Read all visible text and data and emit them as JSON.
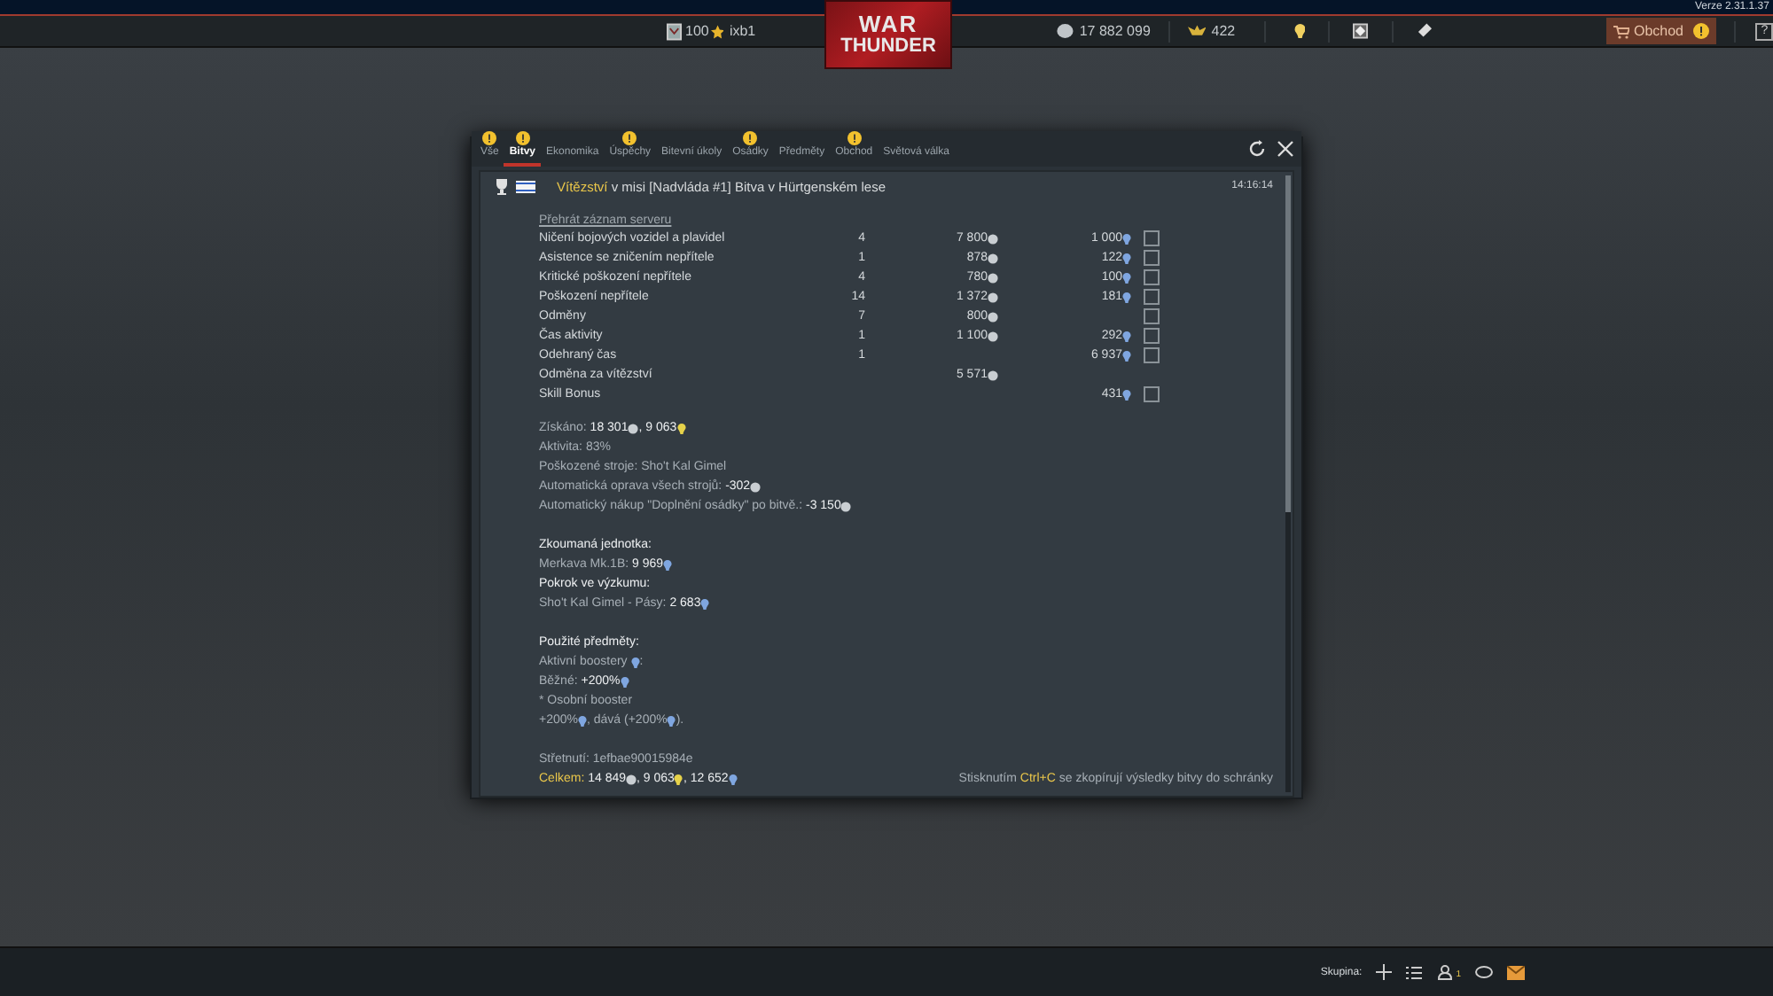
{
  "top_bar": {
    "version": "Verze 2.31.1.37",
    "rank": "100",
    "nickname": "ixb1",
    "logo": {
      "line_1": "WAR",
      "line_2": "THUNDER"
    },
    "silver": "17 882 099",
    "golden_eagles": "422",
    "shop": {
      "label": "Obchod",
      "alert": true
    },
    "help": "?"
  },
  "tabs": [
    {
      "label": "Vše",
      "selected": false,
      "alert": true
    },
    {
      "label": "Bitvy",
      "selected": true,
      "alert": true
    },
    {
      "label": "Ekonomika",
      "selected": false,
      "alert": false
    },
    {
      "label": "Úspěchy",
      "selected": false,
      "alert": true
    },
    {
      "label": "Bitevní úkoly",
      "selected": false,
      "alert": false
    },
    {
      "label": "Osádky",
      "selected": false,
      "alert": true
    },
    {
      "label": "Předměty",
      "selected": false,
      "alert": false
    },
    {
      "label": "Obchod",
      "selected": false,
      "alert": true
    },
    {
      "label": "Světová válka",
      "selected": false,
      "alert": false
    }
  ],
  "message": {
    "result": "Vítězství",
    "title": " v misi [Nadvláda #1] Bitva v Hürtgenském lese",
    "time": "14:16:14",
    "replay_link": "Přehrát záznam serveru",
    "rows": [
      {
        "name": "Ničení bojových vozidel a plavidel",
        "count": "4",
        "silver": "7 800",
        "rp": "1 000",
        "help": true
      },
      {
        "name": "Asistence se zničením nepřítele",
        "count": "1",
        "silver": "878",
        "rp": "122",
        "help": true
      },
      {
        "name": "Kritické poškození nepřítele",
        "count": "4",
        "silver": "780",
        "rp": "100",
        "help": true
      },
      {
        "name": "Poškození nepřítele",
        "count": "14",
        "silver": "1 372",
        "rp": "181",
        "help": true
      },
      {
        "name": "Odměny",
        "count": "7",
        "silver": "800",
        "rp": "",
        "help": true
      },
      {
        "name": "Čas aktivity",
        "count": "1",
        "silver": "1 100",
        "rp": "292",
        "help": true
      },
      {
        "name": "Odehraný čas",
        "count": "1",
        "silver": "",
        "rp": "6 937",
        "help": true
      },
      {
        "name": "Odměna za vítězství",
        "count": "",
        "silver": "5 571",
        "rp": "",
        "help": false
      },
      {
        "name": "Skill Bonus",
        "count": "",
        "silver": "",
        "rp": "431",
        "help": true
      }
    ],
    "summary": [
      [
        [
          {
            "kind": "text",
            "text": "Získáno: "
          },
          {
            "kind": "strong",
            "text": "18 301"
          },
          {
            "kind": "silver"
          },
          {
            "kind": "strong",
            "text": ", 9 063"
          },
          {
            "kind": "free_rp"
          }
        ],
        [
          {
            "kind": "text",
            "text": "Aktivita: 83%"
          }
        ],
        [
          {
            "kind": "text",
            "text": "Poškozené stroje: Sho't Kal Gimel"
          }
        ],
        [
          {
            "kind": "text",
            "text": "Automatická oprava všech strojů: "
          },
          {
            "kind": "strong",
            "text": "-302"
          },
          {
            "kind": "silver"
          }
        ],
        [
          {
            "kind": "text",
            "text": "Automatický nákup \"Doplnění osádky\" po bitvě.: "
          },
          {
            "kind": "strong",
            "text": "-3 150"
          },
          {
            "kind": "silver"
          }
        ]
      ],
      [
        [
          {
            "kind": "strong",
            "text": "Zkoumaná jednotka:"
          }
        ],
        [
          {
            "kind": "text",
            "text": "Merkava Mk.1B: "
          },
          {
            "kind": "strong",
            "text": "9 969"
          },
          {
            "kind": "rp"
          }
        ],
        [
          {
            "kind": "strong",
            "text": "Pokrok ve výzkumu:"
          }
        ],
        [
          {
            "kind": "text",
            "text": "Sho't Kal Gimel - Pásy: "
          },
          {
            "kind": "strong",
            "text": "2 683"
          },
          {
            "kind": "rp"
          }
        ]
      ],
      [
        [
          {
            "kind": "strong",
            "text": "Použité předměty:"
          }
        ],
        [
          {
            "kind": "text",
            "text": "Aktivní boostery "
          },
          {
            "kind": "rp"
          },
          {
            "kind": "text",
            "text": ":"
          }
        ],
        [
          {
            "kind": "text",
            "text": "Běžné: "
          },
          {
            "kind": "strong",
            "text": "+200%"
          },
          {
            "kind": "rp"
          }
        ],
        [
          {
            "kind": "text",
            "text": "* Osobní booster"
          }
        ],
        [
          {
            "kind": "text",
            "text": "+200%"
          },
          {
            "kind": "rp"
          },
          {
            "kind": "text",
            "text": ", dává (+200%"
          },
          {
            "kind": "rp"
          },
          {
            "kind": "text",
            "text": ")."
          }
        ]
      ],
      [
        [
          {
            "kind": "text",
            "text": "Střetnutí: 1efbae90015984e"
          }
        ]
      ]
    ],
    "total": [
      {
        "kind": "highlight",
        "text": "Celkem: "
      },
      {
        "kind": "strong",
        "text": "14 849"
      },
      {
        "kind": "silver"
      },
      {
        "kind": "strong",
        "text": ", 9 063"
      },
      {
        "kind": "free_rp"
      },
      {
        "kind": "strong",
        "text": ", 12 652"
      },
      {
        "kind": "rp"
      }
    ],
    "hint": [
      {
        "kind": "text",
        "text": "Stisknutím "
      },
      {
        "kind": "highlight",
        "text": "Ctrl+C"
      },
      {
        "kind": "text",
        "text": " se zkopírují výsledky bitvy do schránky"
      }
    ]
  },
  "bottom_bar": {
    "squad_label": "Skupina:",
    "contacts_count": "1"
  }
}
